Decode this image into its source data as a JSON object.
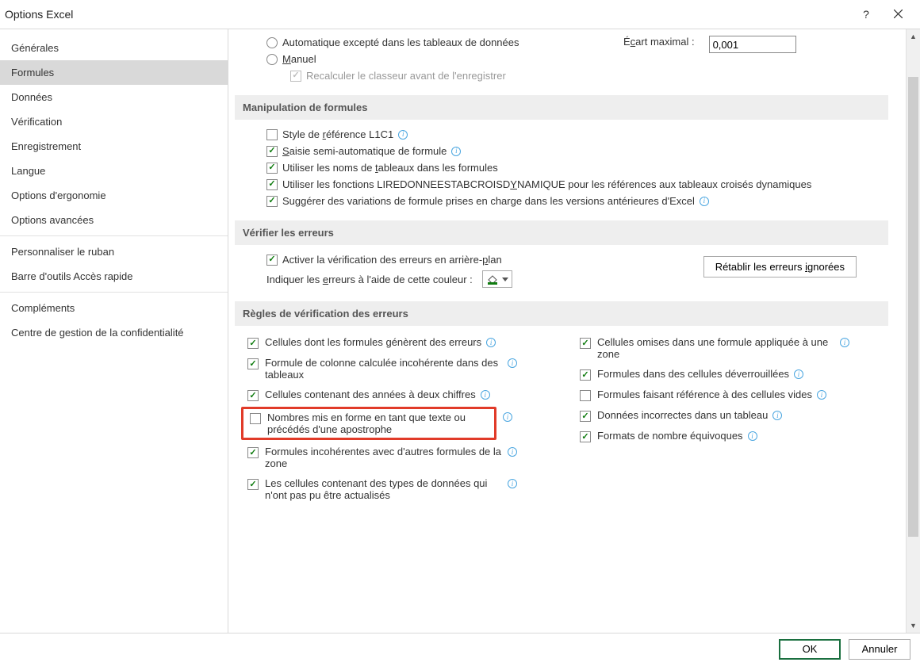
{
  "title": "Options Excel",
  "sidebar": {
    "items": [
      "Générales",
      "Formules",
      "Données",
      "Vérification",
      "Enregistrement",
      "Langue",
      "Options d'ergonomie",
      "Options avancées",
      "Personnaliser le ruban",
      "Barre d'outils Accès rapide",
      "Compléments",
      "Centre de gestion de la confidentialité"
    ]
  },
  "top": {
    "auto_except": "Automatique excepté dans les tableaux de données",
    "manual": "Manuel",
    "recalc": "Recalculer le classeur avant de l'enregistrer",
    "ecart_label": "Écart maximal :",
    "ecart_value": "0,001"
  },
  "sec_formulas": "Manipulation de formules",
  "formulas": {
    "ref_style": "Style de référence L1C1",
    "autocomplete": "Saisie semi-automatique de formule",
    "table_names": "Utiliser les noms de tableaux dans les formules",
    "getpivot": "Utiliser les fonctions LIREDONNEESTABCROISDYNAMIQUE pour les références aux tableaux croisés dynamiques",
    "suggest": "Suggérer des variations de formule prises en charge dans les versions antérieures d'Excel"
  },
  "sec_verify": "Vérifier les erreurs",
  "verify": {
    "enable_bg": "Activer la vérification des erreurs en arrière-plan",
    "color_label": "Indiquer les erreurs à l'aide de cette couleur :",
    "reset_btn": "Rétablir les erreurs ignorées"
  },
  "sec_rules": "Règles de vérification des erreurs",
  "rules_left": [
    {
      "checked": true,
      "label": "Cellules dont les formules génèrent des erreurs",
      "info": true
    },
    {
      "checked": true,
      "label": "Formule de colonne calculée incohérente dans des tableaux",
      "info": true
    },
    {
      "checked": true,
      "label": "Cellules contenant des années à deux chiffres",
      "info": true
    },
    {
      "checked": false,
      "label": "Nombres mis en forme en tant que texte ou précédés d'une apostrophe",
      "info": true,
      "highlight": true
    },
    {
      "checked": true,
      "label": "Formules incohérentes avec d'autres formules de la zone",
      "info": true
    },
    {
      "checked": true,
      "label": "Les cellules contenant des types de données qui n'ont pas pu être actualisés",
      "info": true
    }
  ],
  "rules_right": [
    {
      "checked": true,
      "label": "Cellules omises dans une formule appliquée à une zone",
      "info": true
    },
    {
      "checked": true,
      "label": "Formules dans des cellules déverrouillées",
      "info": true
    },
    {
      "checked": false,
      "label": "Formules faisant référence à des cellules vides",
      "info": true
    },
    {
      "checked": true,
      "label": "Données incorrectes dans un tableau",
      "info": true
    },
    {
      "checked": true,
      "label": "Formats de nombre équivoques",
      "info": true
    }
  ],
  "footer": {
    "ok": "OK",
    "cancel": "Annuler"
  }
}
